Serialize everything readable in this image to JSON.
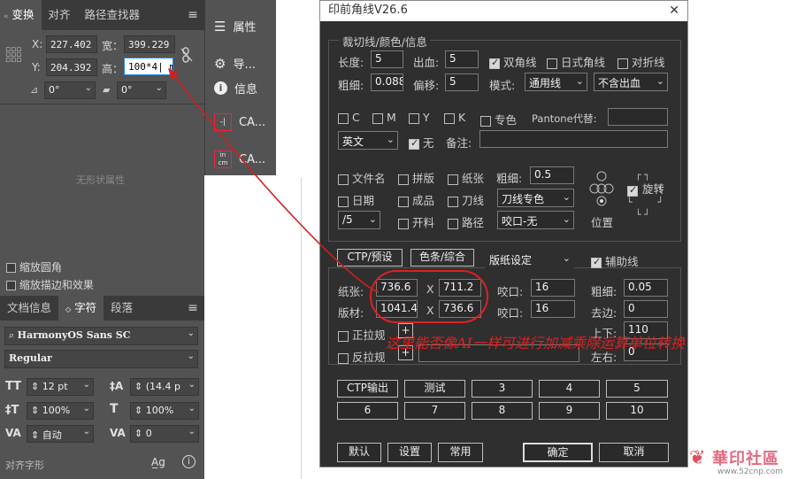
{
  "left_panel": {
    "tabs": [
      "变换",
      "对齐",
      "路径查找器"
    ],
    "x_label": "X:",
    "x_value": "227.402 r",
    "y_label": "Y:",
    "y_value": "204.392 r",
    "w_label": "宽：",
    "w_value": "399.229 r",
    "h_label": "高：",
    "h_value": "100*4| mm",
    "angle_value": "0°",
    "shear_value": "0°",
    "no_shape": "无形状属性",
    "scale_corners": "缩放圆角",
    "scale_strokes": "缩放描边和效果",
    "char_tabs": [
      "文档信息",
      "字符",
      "段落"
    ],
    "font_family": "HarmonyOS Sans SC",
    "font_style": "Regular",
    "font_size": "12 pt",
    "leading": "(14.4 p",
    "vscale": "100%",
    "hscale": "100%",
    "kerning": "自动",
    "tracking": "0",
    "align_glyphs": "对齐字形"
  },
  "mid_panel": {
    "items": [
      "属性",
      "导...",
      "信息",
      "CA...",
      "CA..."
    ]
  },
  "dialog": {
    "title": "印前角线V26.6",
    "close": "X",
    "section1": "裁切线/颜色/信息",
    "len_label": "长度:",
    "len_value": "5",
    "bleed_label": "出血:",
    "bleed_value": "5",
    "double_corner": "双角线",
    "jp_corner": "日式角线",
    "fold_line": "对折线",
    "thick_label": "粗细:",
    "thick_value": "0.088",
    "offset_label": "偏移:",
    "offset_value": "5",
    "mode_label": "模式:",
    "mode_value": "通用线",
    "bleed_mode": "不含出血",
    "c": "C",
    "m": "M",
    "y": "Y",
    "k": "K",
    "spot": "专色",
    "pantone": "Pantone代替:",
    "lang": "英文",
    "none": "无",
    "note": "备注:",
    "filename": "文件名",
    "imposition": "拼版",
    "paper": "纸张",
    "thick2_label": "粗细:",
    "thick2_value": "0.5",
    "date": "日期",
    "finished": "成品",
    "knife": "刀线",
    "knife_color": "刀线专色",
    "rotate": "旋转",
    "slash5": "/5",
    "cut": "开料",
    "path": "路径",
    "bite": "咬口-无",
    "position": "位置",
    "ctp_btn": "CTP/预设",
    "colorbar_btn": "色条/综合",
    "paper_setting": "版纸设定",
    "aux_line": "辅助线",
    "paper_label": "纸张:",
    "paper_w": "736.6",
    "paper_h": "711.2",
    "plate_label": "版材:",
    "plate_w": "1041.4",
    "plate_h": "736.6",
    "x1": "X",
    "x2": "X",
    "bite1_label": "咬口:",
    "bite1_value": "16",
    "bite2_label": "咬口:",
    "bite2_value": "16",
    "thick3_label": "粗细:",
    "thick3_value": "0.05",
    "trim_label": "去边:",
    "trim_value": "0",
    "up_down_label": "上下:",
    "up_down_value": "110",
    "lr_label": "左右:",
    "lr_value": "0",
    "pull_front": "正拉规",
    "pull_back": "反拉规",
    "plus": "+",
    "grid_buttons": [
      "CTP输出",
      "测试",
      "3",
      "4",
      "5",
      "6",
      "7",
      "8",
      "9",
      "10"
    ],
    "default": "默认",
    "settings": "设置",
    "common": "常用",
    "ok": "确定",
    "cancel": "取消"
  },
  "annotation": "这里能否像AI一样可进行加减乘除运算单位转换",
  "watermark": {
    "name": "華印社區",
    "url": "www.52cnp.com"
  }
}
